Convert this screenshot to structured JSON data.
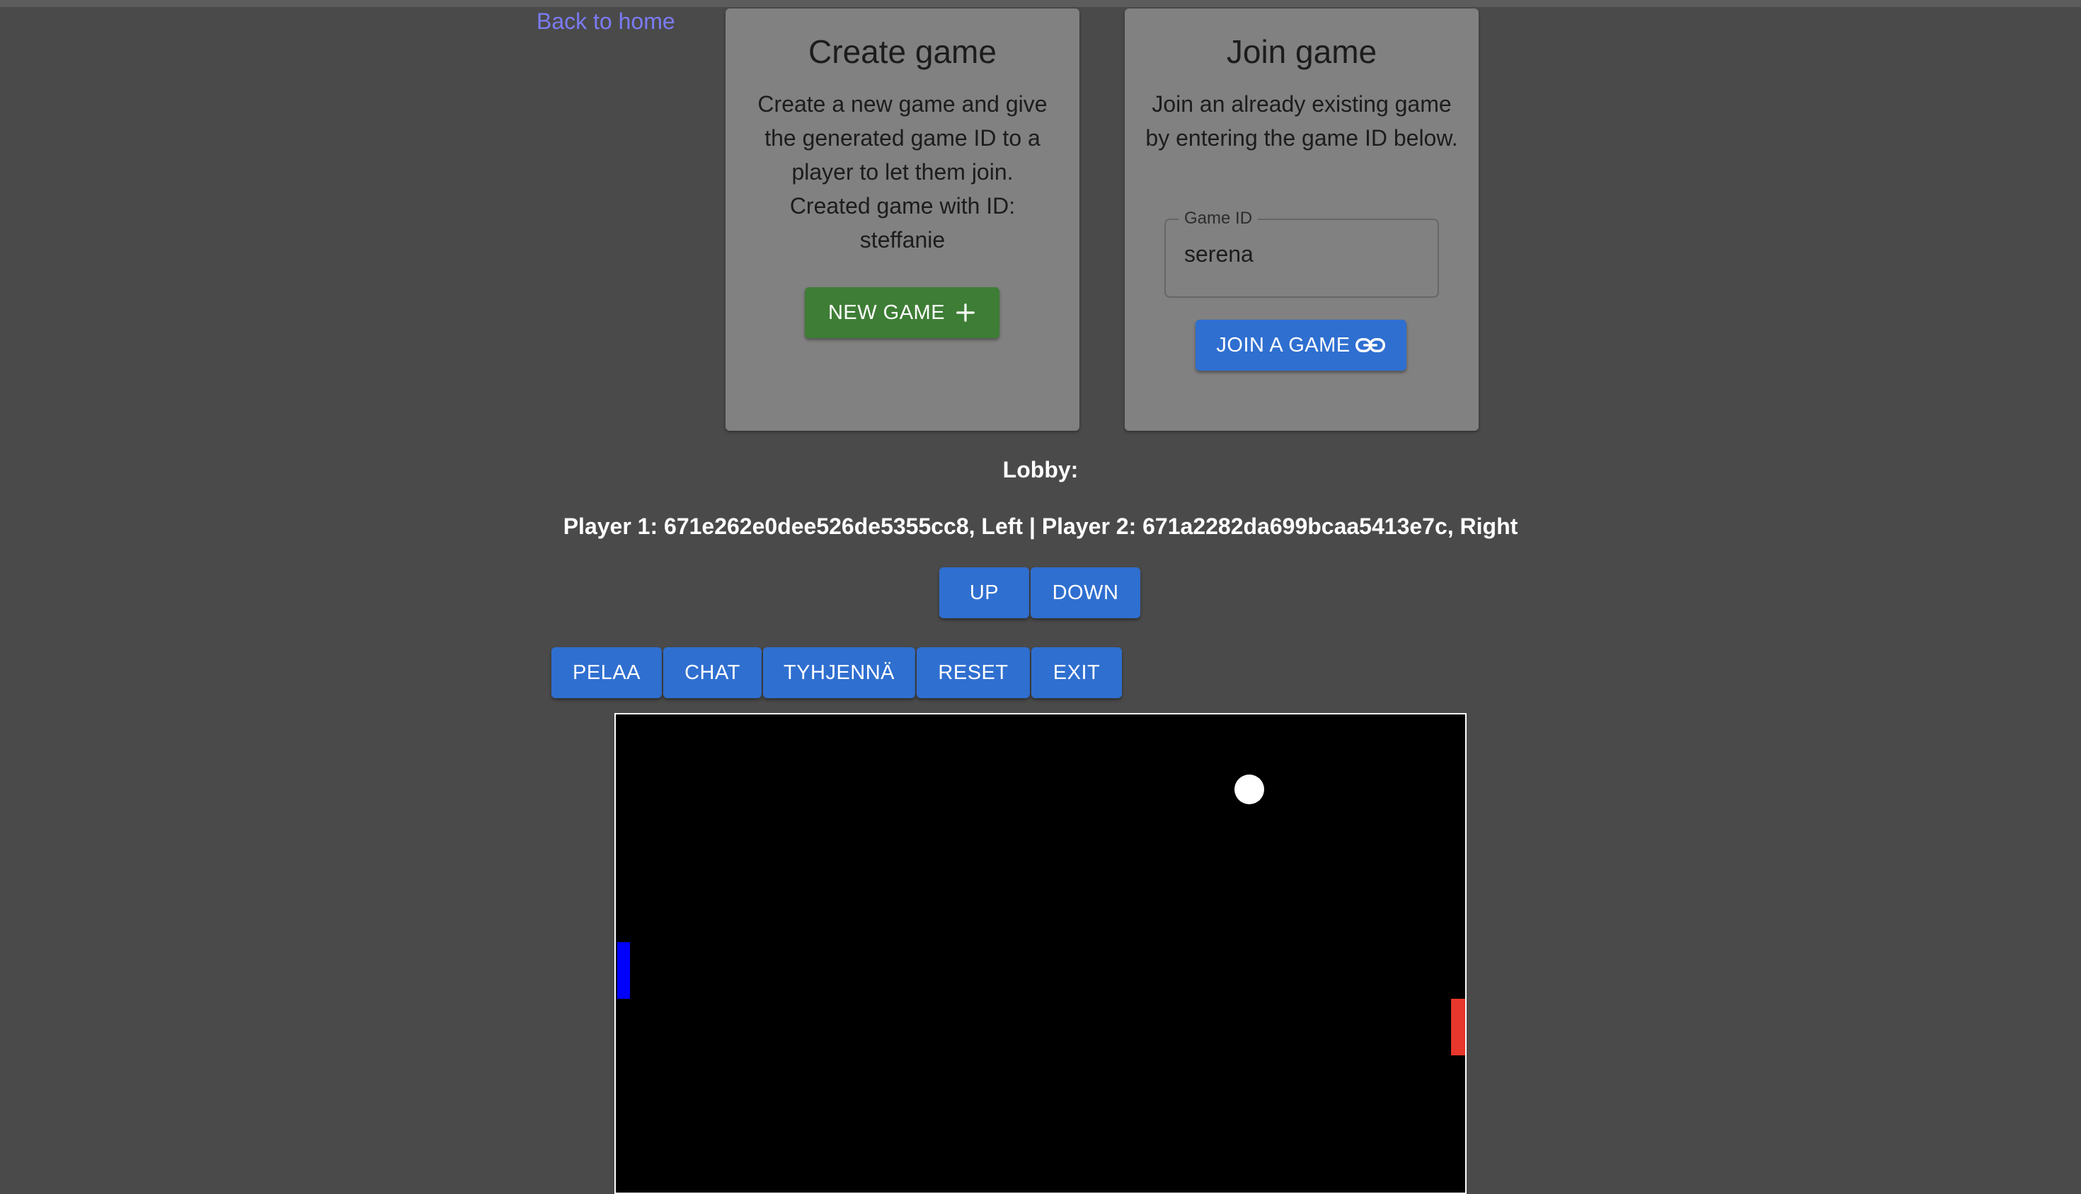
{
  "nav": {
    "back_label": "Back to home"
  },
  "create_card": {
    "title": "Create game",
    "description": "Create a new game and give the generated game ID to a player to let them join.",
    "created_line": "Created game with ID:",
    "created_id": "steffanie",
    "button_label": "NEW GAME",
    "button_icon": "plus-icon"
  },
  "join_card": {
    "title": "Join game",
    "description": "Join an already existing game by entering the game ID below.",
    "field_label": "Game ID",
    "field_value": "serena",
    "button_label": "JOIN A GAME",
    "button_icon": "link-icon"
  },
  "lobby": {
    "title": "Lobby:",
    "players": "Player 1: 671e262e0dee526de5355cc8, Left | Player 2: 671a2282da699bcaa5413e7c, Right"
  },
  "controls": {
    "up_label": "UP",
    "down_label": "DOWN"
  },
  "actions": {
    "pelaa_label": "PELAA",
    "chat_label": "CHAT",
    "tyhjenna_label": "TYHJENNÄ",
    "reset_label": "RESET",
    "exit_label": "EXIT"
  },
  "game": {
    "left_paddle_color": "#0000ff",
    "right_paddle_color": "#e8372c",
    "ball_color": "#ffffff",
    "board_color": "#000000"
  },
  "colors": {
    "page_background": "#4a4a4a",
    "card_background": "#818181",
    "link": "#7b7bf5",
    "primary_button": "#2f6fd0",
    "success_button": "#3e7d35"
  }
}
